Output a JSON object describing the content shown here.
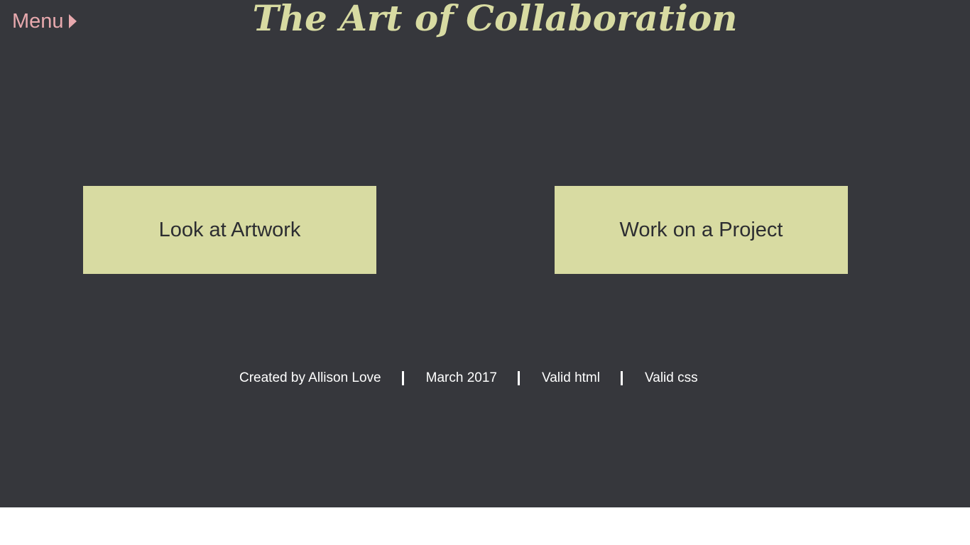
{
  "header": {
    "menu_label": "Menu",
    "title": "The Art of Collaboration"
  },
  "main": {
    "choices": [
      {
        "label": "Look at Artwork"
      },
      {
        "label": "Work on a Project"
      }
    ]
  },
  "footer": {
    "credit": "Created by Allison Love",
    "date": "March 2017",
    "valid_html": "Valid html",
    "valid_css": "Valid css",
    "separator": "|"
  },
  "colors": {
    "background": "#36373c",
    "accent": "#d8dba2",
    "menu": "#e8a9ae",
    "below_page": "#ffffff"
  },
  "icons": {
    "menu_caret": "caret-right-icon"
  }
}
